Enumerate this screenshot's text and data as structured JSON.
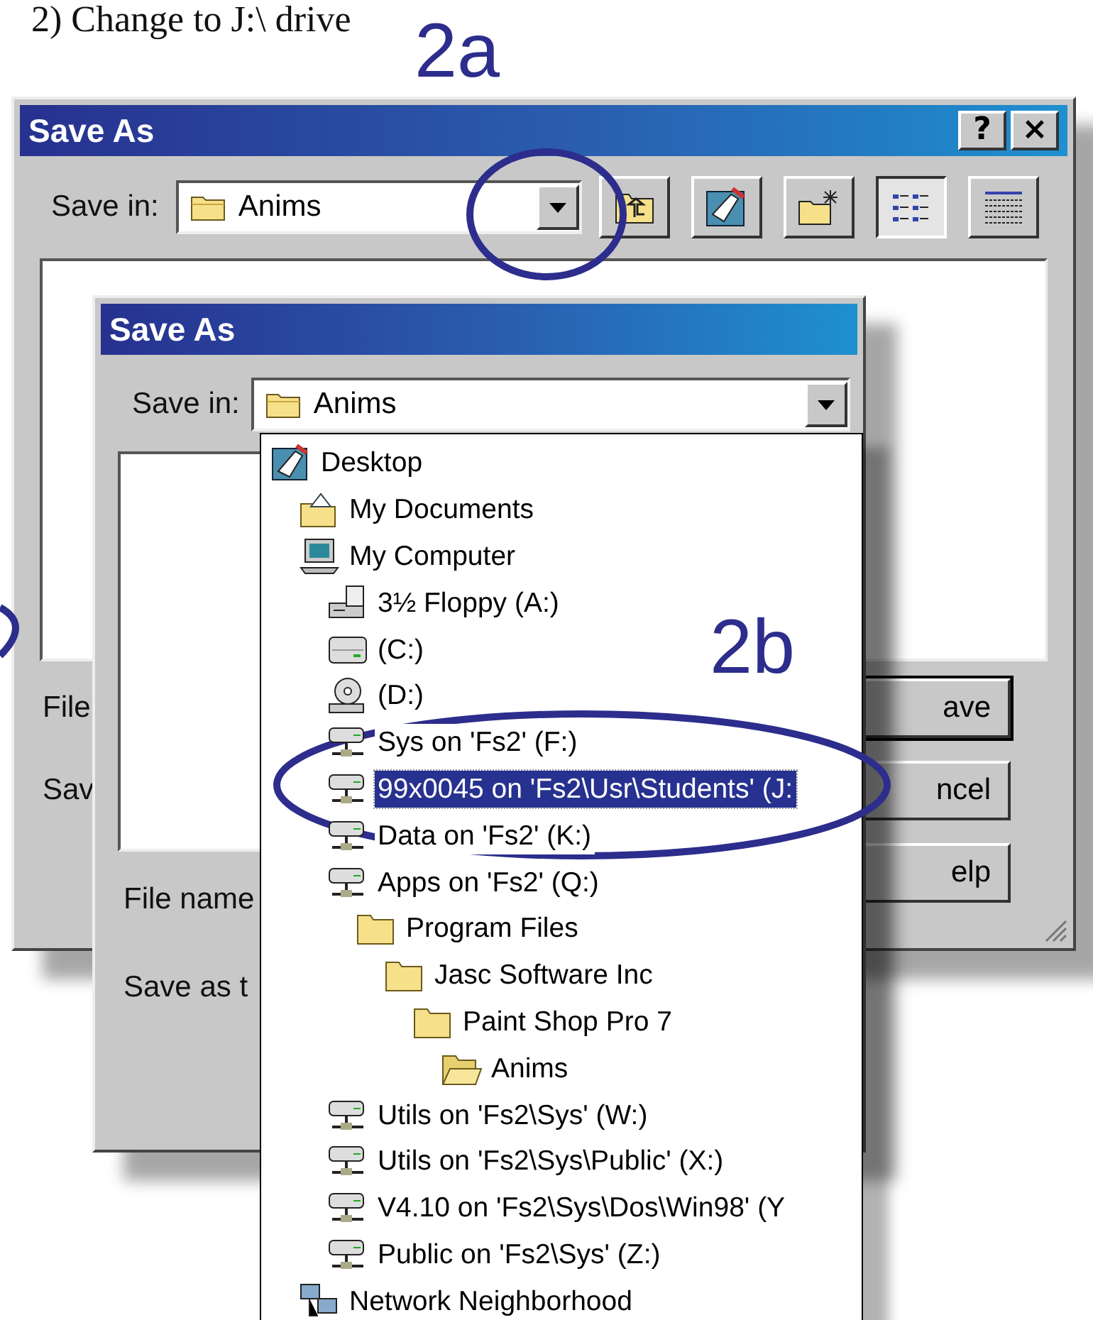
{
  "heading": "2) Change to J:\\ drive",
  "annotations": [
    {
      "label": "2a"
    },
    {
      "label": "2b"
    }
  ],
  "back_dialog": {
    "title": "Save As",
    "title_buttons": [
      "?",
      "×"
    ],
    "save_in_label": "Save in:",
    "save_in_value": "Anims",
    "labels": [
      "File",
      "Sav"
    ],
    "buttons": [
      "ave",
      "ncel",
      "elp"
    ]
  },
  "front_dialog": {
    "title": "Save As",
    "save_in_label": "Save in:",
    "save_in_value": "Anims",
    "labels": [
      "File name",
      "Save as t"
    ]
  },
  "dropdown": {
    "items": [
      {
        "label": "Desktop",
        "kind": "desktop",
        "selected": false,
        "children": [
          {
            "label": "My Documents",
            "kind": "documents",
            "selected": false
          },
          {
            "label": "My Computer",
            "kind": "computer",
            "selected": false,
            "children": [
              {
                "label": "3½ Floppy (A:)",
                "kind": "floppy",
                "selected": false
              },
              {
                "label": "(C:)",
                "kind": "drive",
                "selected": false
              },
              {
                "label": "(D:)",
                "kind": "cdrom",
                "selected": false
              },
              {
                "label": "Sys on 'Fs2' (F:)",
                "kind": "network-drive",
                "selected": false
              },
              {
                "label": "99x0045 on 'Fs2\\Usr\\Students' (J:",
                "kind": "network-drive",
                "selected": true
              },
              {
                "label": "Data on 'Fs2' (K:)",
                "kind": "network-drive",
                "selected": false
              },
              {
                "label": "Apps on 'Fs2' (Q:)",
                "kind": "network-drive",
                "selected": false,
                "children": [
                  {
                    "label": "Program Files",
                    "kind": "folder",
                    "selected": false,
                    "children": [
                      {
                        "label": "Jasc Software Inc",
                        "kind": "folder",
                        "selected": false,
                        "children": [
                          {
                            "label": "Paint Shop Pro 7",
                            "kind": "folder",
                            "selected": false,
                            "children": [
                              {
                                "label": "Anims",
                                "kind": "open-folder",
                                "selected": false
                              }
                            ]
                          }
                        ]
                      }
                    ]
                  }
                ]
              },
              {
                "label": "Utils on 'Fs2\\Sys' (W:)",
                "kind": "network-drive",
                "selected": false
              },
              {
                "label": "Utils on 'Fs2\\Sys\\Public' (X:)",
                "kind": "network-drive",
                "selected": false
              },
              {
                "label": "V4.10 on 'Fs2\\Sys\\Dos\\Win98' (Y",
                "kind": "network-drive",
                "selected": false
              },
              {
                "label": "Public on 'Fs2\\Sys' (Z:)",
                "kind": "network-drive",
                "selected": false
              }
            ]
          },
          {
            "label": "Network Neighborhood",
            "kind": "network",
            "selected": false
          }
        ]
      }
    ]
  }
}
